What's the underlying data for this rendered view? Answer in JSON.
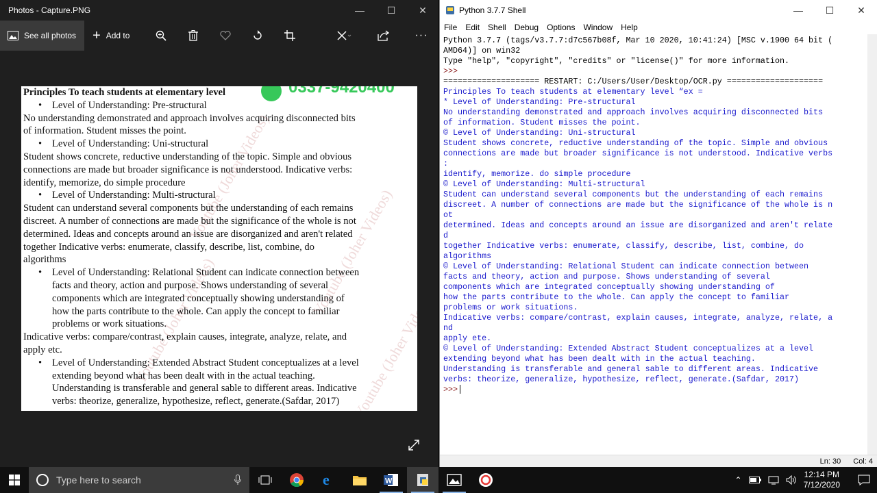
{
  "photos": {
    "title": "Photos - Capture.PNG",
    "see_all": "See all photos",
    "add_to": "Add to",
    "doc_heading": "Principles To teach students at elementary level",
    "doc_lines": [
      {
        "t": "b",
        "text": "Level of Understanding: Pre-structural"
      },
      {
        "t": "p",
        "text": "No understanding demonstrated and approach involves acquiring disconnected bits"
      },
      {
        "t": "p",
        "text": "of information. Student misses the point."
      },
      {
        "t": "b",
        "text": "Level of Understanding: Uni-structural"
      },
      {
        "t": "p",
        "text": "Student shows concrete, reductive understanding of the topic. Simple and obvious"
      },
      {
        "t": "p",
        "text": "connections are made but broader significance is not understood. Indicative verbs:"
      },
      {
        "t": "p",
        "text": "identify, memorize, do simple procedure"
      },
      {
        "t": "b",
        "text": "Level of Understanding: Multi-structural"
      },
      {
        "t": "p",
        "text": "Student can understand several components but the understanding of each remains"
      },
      {
        "t": "p",
        "text": "discreet. A number of connections are made but the significance of the whole is not"
      },
      {
        "t": "p",
        "text": "determined. Ideas and concepts around an issue are disorganized and aren't related"
      },
      {
        "t": "p",
        "text": "together Indicative verbs: enumerate, classify, describe, list, combine, do"
      },
      {
        "t": "p",
        "text": "algorithms"
      },
      {
        "t": "b",
        "text": "Level of Understanding: Relational Student can indicate connection between"
      },
      {
        "t": "c",
        "text": "facts and theory, action and purpose. Shows understanding of several"
      },
      {
        "t": "c",
        "text": "components which are integrated conceptually showing understanding of"
      },
      {
        "t": "c",
        "text": "how the parts contribute to the whole. Can apply the concept to familiar"
      },
      {
        "t": "c",
        "text": "problems or work situations."
      },
      {
        "t": "p",
        "text": "Indicative verbs: compare/contrast, explain causes, integrate, analyze, relate, and"
      },
      {
        "t": "p",
        "text": "apply etc."
      },
      {
        "t": "b",
        "text": "Level of Understanding: Extended Abstract Student conceptualizes at a level"
      },
      {
        "t": "c",
        "text": "extending beyond what has been dealt with in the actual teaching."
      },
      {
        "t": "c",
        "text": "Understanding is transferable and general sable to different areas. Indicative"
      },
      {
        "t": "c",
        "text": "verbs: theorize, generalize, hypothesize, reflect, generate.(Safdar, 2017)"
      }
    ],
    "watermark": "Youtube (Joher Videos)",
    "phone": "0337-9420400"
  },
  "shell": {
    "title": "Python 3.7.7 Shell",
    "menu": [
      "File",
      "Edit",
      "Shell",
      "Debug",
      "Options",
      "Window",
      "Help"
    ],
    "lines": [
      {
        "c": "k",
        "text": "Python 3.7.7 (tags/v3.7.7:d7c567b08f, Mar 10 2020, 10:41:24) [MSC v.1900 64 bit ("
      },
      {
        "c": "k",
        "text": "AMD64)] on win32"
      },
      {
        "c": "k",
        "text": "Type \"help\", \"copyright\", \"credits\" or \"license()\" for more information."
      },
      {
        "c": "p",
        "text": ">>>"
      },
      {
        "c": "k",
        "text": "==================== RESTART: C:/Users/User/Desktop/OCR.py ===================="
      },
      {
        "c": "o",
        "text": "Principles To teach students at elementary level “ex ="
      },
      {
        "c": "o",
        "text": "* Level of Understanding: Pre-structural"
      },
      {
        "c": "o",
        "text": "No understanding demonstrated and approach involves acquiring disconnected bits"
      },
      {
        "c": "o",
        "text": "of information. Student misses the point."
      },
      {
        "c": "o",
        "text": "© Level of Understanding: Uni-structural"
      },
      {
        "c": "o",
        "text": "Student shows concrete, reductive understanding of the topic. Simple and obvious"
      },
      {
        "c": "o",
        "text": "connections are made but broader significance is not understood. Indicative verbs"
      },
      {
        "c": "o",
        "text": ":"
      },
      {
        "c": "o",
        "text": "identify, memorize. do simple procedure"
      },
      {
        "c": "o",
        "text": "© Level of Understanding: Multi-structural"
      },
      {
        "c": "o",
        "text": "Student can understand several components but the understanding of each remains"
      },
      {
        "c": "o",
        "text": "discreet. A number of connections are made but the significance of the whole is n"
      },
      {
        "c": "o",
        "text": "ot"
      },
      {
        "c": "o",
        "text": "determined. Ideas and concepts around an issue are disorganized and aren't relate"
      },
      {
        "c": "o",
        "text": "d"
      },
      {
        "c": "o",
        "text": "together Indicative verbs: enumerate, classify, describe, list, combine, do"
      },
      {
        "c": "o",
        "text": "algorithms"
      },
      {
        "c": "o",
        "text": "© Level of Understanding: Relational Student can indicate connection between"
      },
      {
        "c": "o",
        "text": "facts and theory, action and purpose. Shows understanding of several"
      },
      {
        "c": "o",
        "text": "components which are integrated conceptually showing understanding of"
      },
      {
        "c": "o",
        "text": "how the parts contribute to the whole. Can apply the concept to familiar"
      },
      {
        "c": "o",
        "text": "problems or work situations."
      },
      {
        "c": "o",
        "text": "Indicative verbs: compare/contrast, explain causes, integrate, analyze, relate, a"
      },
      {
        "c": "o",
        "text": "nd"
      },
      {
        "c": "o",
        "text": "apply ete."
      },
      {
        "c": "o",
        "text": "© Level of Understanding: Extended Abstract Student conceptualizes at a level"
      },
      {
        "c": "o",
        "text": "extending beyond what has been dealt with in the actual teaching."
      },
      {
        "c": "o",
        "text": "Understanding is transferable and general sable to different areas. Indicative"
      },
      {
        "c": "o",
        "text": "verbs: theorize, generalize, hypothesize, reflect, generate.(Safdar, 2017)"
      }
    ],
    "prompt": ">>>",
    "status_ln": "Ln: 30",
    "status_col": "Col: 4"
  },
  "taskbar": {
    "search_placeholder": "Type here to search",
    "time": "12:14 PM",
    "date": "7/12/2020"
  },
  "colors": {
    "shell_output": "#1a1acc",
    "shell_prompt": "#8a1a1a",
    "taskbar": "#101010"
  }
}
